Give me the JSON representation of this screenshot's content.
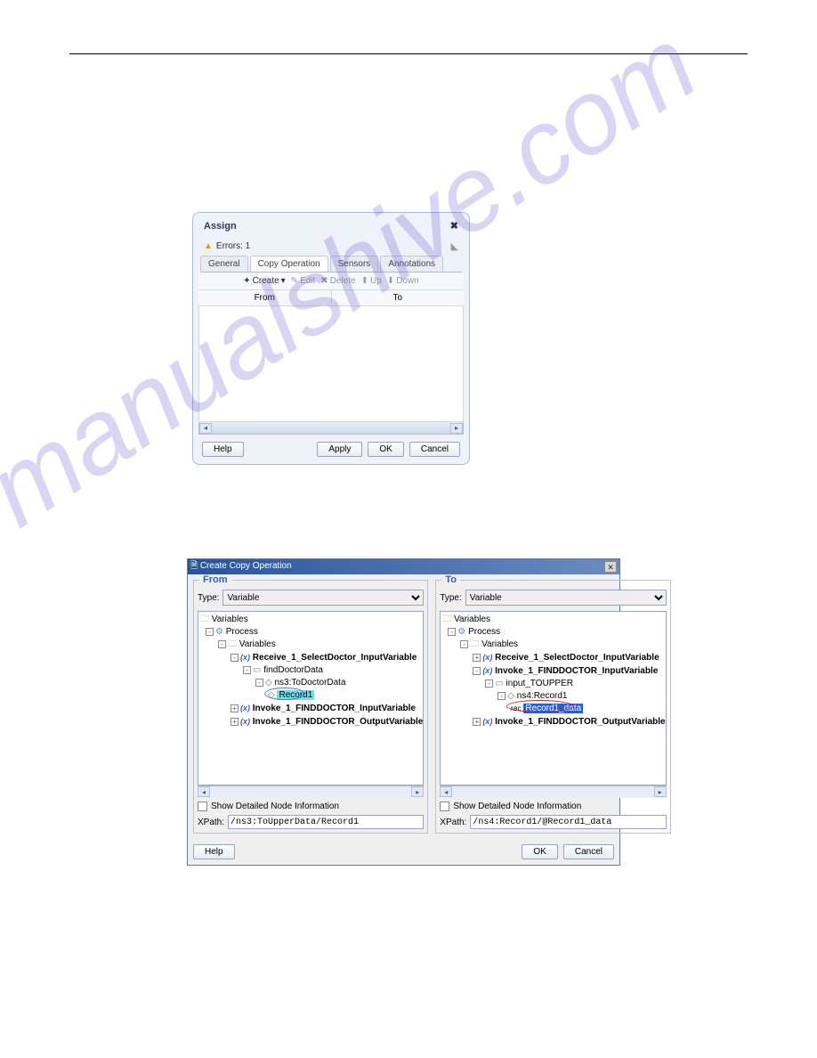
{
  "assign": {
    "title": "Assign",
    "errors": "Errors: 1",
    "tabs": [
      "General",
      "Copy Operation",
      "Sensors",
      "Annotations"
    ],
    "active_tab": 1,
    "toolbar": {
      "create": "Create",
      "edit": "Edit",
      "delete": "Delete",
      "up": "Up",
      "down": "Down"
    },
    "cols": {
      "from": "From",
      "to": "To"
    },
    "buttons": {
      "help": "Help",
      "apply": "Apply",
      "ok": "OK",
      "cancel": "Cancel"
    }
  },
  "copyop": {
    "title": "Create Copy Operation",
    "from_label": "From",
    "to_label": "To",
    "type_label": "Type:",
    "type_value": "Variable",
    "detail_label": "Show Detailed Node Information",
    "xpath_label": "XPath:",
    "tree": {
      "root": "Variables",
      "process": "Process",
      "variables": "Variables",
      "receive": "Receive_1_SelectDoctor_InputVariable",
      "findDoctorData": "findDoctorData",
      "ns3ToDoctor": "ns3:ToDoctorData",
      "record1": "Record1",
      "invoke_in": "Invoke_1_FINDDOCTOR_InputVariable",
      "invoke_out": "Invoke_1_FINDDOCTOR_OutputVariable",
      "input_toupper": "input_TOUPPER",
      "ns4record1": "ns4:Record1",
      "record1_data": "Record1_data"
    },
    "xpath_from": "/ns3:ToUpperData/Record1",
    "xpath_to": "/ns4:Record1/@Record1_data",
    "buttons": {
      "help": "Help",
      "ok": "OK",
      "cancel": "Cancel"
    }
  },
  "watermark": "manualshive.com"
}
